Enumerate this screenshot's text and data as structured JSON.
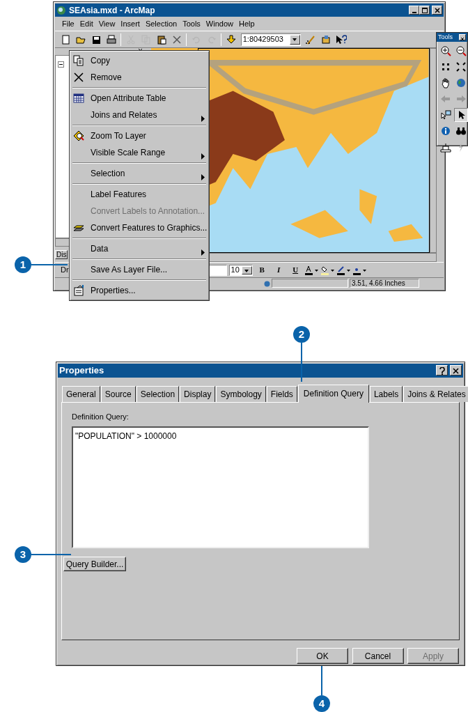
{
  "arcmap_window": {
    "title": "SEAsia.mxd - ArcMap",
    "menu_bar": [
      "File",
      "Edit",
      "View",
      "Insert",
      "Selection",
      "Tools",
      "Window",
      "Help"
    ],
    "toolbar": {
      "scale": "1:80429503",
      "tools": [
        {
          "disabled": false
        },
        {
          "disabled": false
        },
        {
          "disabled": false
        },
        {
          "disabled": false
        },
        {
          "disabled": true
        },
        {
          "disabled": true
        },
        {
          "disabled": false
        },
        {
          "disabled": false
        },
        {
          "disabled": true
        },
        {
          "disabled": true
        },
        {
          "disabled": false
        }
      ]
    },
    "toc_tab": "Dis",
    "drawing_menu": "Dr",
    "drawing_toolbar": {
      "font_size": "10",
      "bold": "B",
      "italic": "I",
      "underline": "U"
    },
    "status_bar": {
      "coordinates": "3.51, 4.66 Inches"
    }
  },
  "tools_palette": {
    "title": "Tools",
    "tools": [
      {
        "selected": false
      },
      {
        "selected": false
      },
      {
        "selected": false
      },
      {
        "selected": false
      },
      {
        "selected": false
      },
      {
        "selected": false
      },
      {
        "selected": false
      },
      {
        "selected": false
      },
      {
        "selected": false
      },
      {
        "selected": true
      },
      {
        "selected": false
      },
      {
        "selected": false
      },
      {
        "selected": false
      },
      {
        "selected": false
      }
    ]
  },
  "context_menu": {
    "items": [
      {
        "kind": "item",
        "label": "Copy",
        "submenu": false,
        "disabled": false
      },
      {
        "kind": "item",
        "label": "Remove",
        "submenu": false,
        "disabled": false
      },
      {
        "kind": "separator"
      },
      {
        "kind": "item",
        "label": "Open Attribute Table",
        "submenu": false,
        "disabled": false
      },
      {
        "kind": "item",
        "label": "Joins and Relates",
        "submenu": true,
        "disabled": false
      },
      {
        "kind": "separator"
      },
      {
        "kind": "item",
        "label": "Zoom To Layer",
        "submenu": false,
        "disabled": false
      },
      {
        "kind": "item",
        "label": "Visible Scale Range",
        "submenu": true,
        "disabled": false
      },
      {
        "kind": "separator"
      },
      {
        "kind": "item",
        "label": "Selection",
        "submenu": true,
        "disabled": false
      },
      {
        "kind": "separator"
      },
      {
        "kind": "item",
        "label": "Label Features",
        "submenu": false,
        "disabled": false
      },
      {
        "kind": "item",
        "label": "Convert Labels to Annotation...",
        "submenu": false,
        "disabled": true
      },
      {
        "kind": "item",
        "label": "Convert Features to Graphics...",
        "submenu": false,
        "disabled": false
      },
      {
        "kind": "separator"
      },
      {
        "kind": "item",
        "label": "Data",
        "submenu": true,
        "disabled": false
      },
      {
        "kind": "separator"
      },
      {
        "kind": "item",
        "label": "Save As Layer File...",
        "submenu": false,
        "disabled": false
      },
      {
        "kind": "separator"
      },
      {
        "kind": "item",
        "label": "Properties...",
        "submenu": false,
        "disabled": false
      }
    ]
  },
  "properties_dialog": {
    "title": "Properties",
    "tabs": [
      {
        "label": "General",
        "selected": false
      },
      {
        "label": "Source",
        "selected": false
      },
      {
        "label": "Selection",
        "selected": false
      },
      {
        "label": "Display",
        "selected": false
      },
      {
        "label": "Symbology",
        "selected": false
      },
      {
        "label": "Fields",
        "selected": false
      },
      {
        "label": "Definition Query",
        "selected": true
      },
      {
        "label": "Labels",
        "selected": false
      },
      {
        "label": "Joins & Relates",
        "selected": false
      }
    ],
    "query_label": "Definition Query:",
    "query": "\"POPULATION\" > 1000000",
    "query_builder_button": "Query Builder...",
    "buttons": [
      {
        "label": "OK",
        "disabled": false
      },
      {
        "label": "Cancel",
        "disabled": false
      },
      {
        "label": "Apply",
        "disabled": true
      }
    ]
  },
  "callouts": [
    "1",
    "2",
    "3",
    "4"
  ]
}
